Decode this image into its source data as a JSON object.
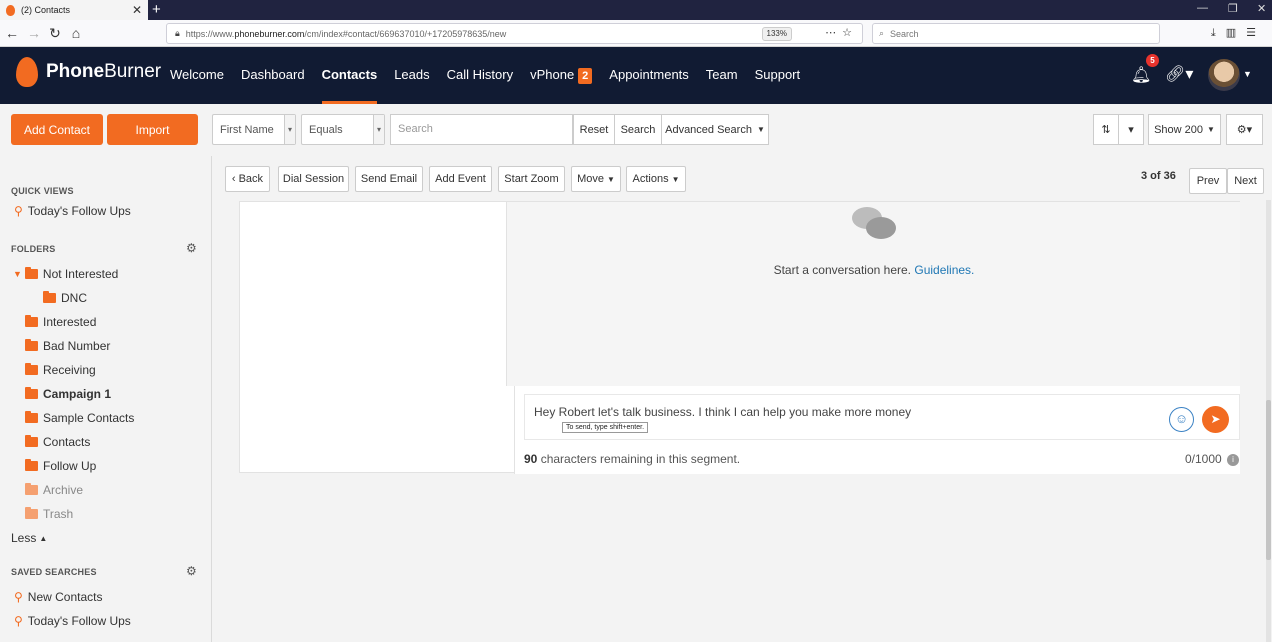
{
  "browser": {
    "tab_title": "(2) Contacts",
    "tab_close": "✕",
    "new_tab": "+",
    "url_prefix": "https://www.",
    "url_host": "phoneburner.com",
    "url_path": "/cm/index#contact/669637010/+17205978635/new",
    "zoom": "133%",
    "search_placeholder": "Search"
  },
  "app": {
    "logo_bold": "Phone",
    "logo_light": "Burner",
    "nav": [
      {
        "label": "Welcome"
      },
      {
        "label": "Dashboard"
      },
      {
        "label": "Contacts"
      },
      {
        "label": "Leads"
      },
      {
        "label": "Call History"
      },
      {
        "label": "vPhone",
        "badge": "2"
      },
      {
        "label": "Appointments"
      },
      {
        "label": "Team"
      },
      {
        "label": "Support"
      }
    ],
    "notification_count": "5"
  },
  "toolbar": {
    "add_contact": "Add Contact",
    "import": "Import",
    "field_select": "First Name",
    "operator_select": "Equals",
    "search_placeholder": "Search",
    "reset": "Reset",
    "search": "Search",
    "advanced_search": "Advanced Search",
    "show": "Show 200"
  },
  "sidebar": {
    "quick_views_heading": "QUICK VIEWS",
    "quick_views": [
      "Today's Follow Ups"
    ],
    "folders_heading": "FOLDERS",
    "folders": [
      {
        "label": "Not Interested"
      },
      {
        "label": "DNC"
      },
      {
        "label": "Interested"
      },
      {
        "label": "Bad Number"
      },
      {
        "label": "Receiving"
      },
      {
        "label": "Campaign 1"
      },
      {
        "label": "Sample Contacts"
      },
      {
        "label": "Contacts"
      },
      {
        "label": "Follow Up"
      },
      {
        "label": "Archive"
      },
      {
        "label": "Trash"
      }
    ],
    "less": "Less",
    "saved_searches_heading": "SAVED SEARCHES",
    "saved_searches": [
      "New Contacts",
      "Today's Follow Ups"
    ]
  },
  "actions": {
    "back": "Back",
    "dial_session": "Dial Session",
    "send_email": "Send Email",
    "add_event": "Add Event",
    "start_zoom": "Start Zoom",
    "move": "Move",
    "actions": "Actions",
    "position": "3 of 36",
    "prev": "Prev",
    "next": "Next"
  },
  "conversation": {
    "start_text": "Start a conversation here.",
    "guidelines_link": "Guidelines.",
    "message_value": "Hey Robert let's talk business. I think I can help you make more money",
    "tooltip": "To send, type shift+enter.",
    "remaining_count": "90",
    "remaining_text": "characters remaining in this segment.",
    "char_count": "0/1000"
  }
}
